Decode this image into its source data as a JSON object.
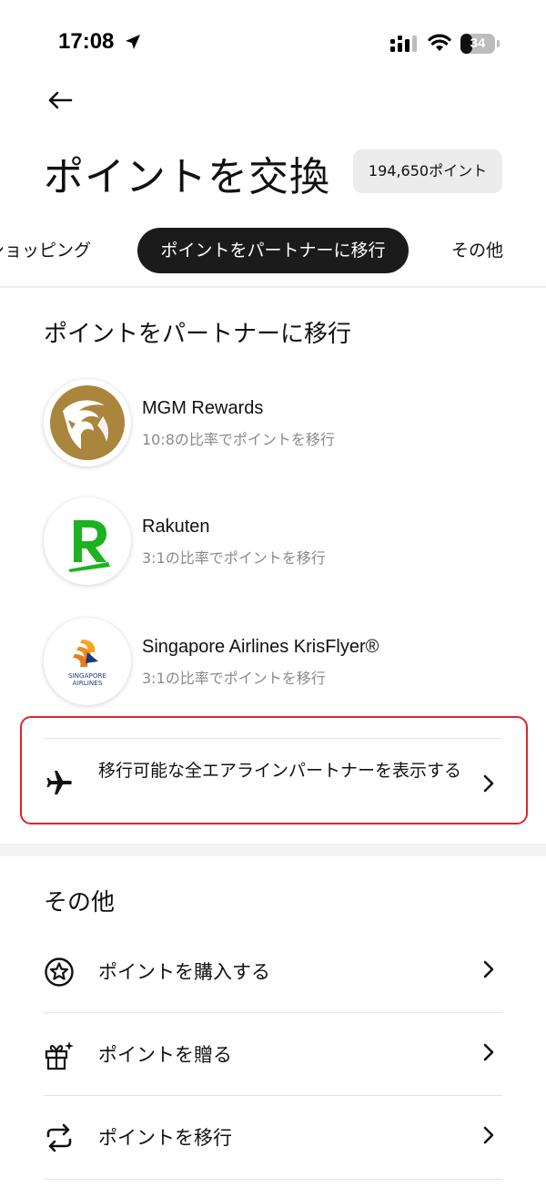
{
  "status_bar": {
    "time": "17:08",
    "battery_level": "34",
    "icons": [
      "location-arrow-icon",
      "signal-icon",
      "wifi-icon",
      "battery-icon"
    ]
  },
  "header": {
    "back_icon": "arrow-left-icon",
    "title": "ポイントを交換",
    "points_badge": "194,650ポイント"
  },
  "tabs": [
    {
      "label": "ショッピング",
      "active": false
    },
    {
      "label": "ポイントをパートナーに移行",
      "active": true
    },
    {
      "label": "その他",
      "active": false
    }
  ],
  "partners_section": {
    "title": "ポイントをパートナーに移行",
    "partners": [
      {
        "name": "MGM Rewards",
        "ratio": "10:8の比率でポイントを移行",
        "logo": "mgm-lion-logo",
        "color": "#A9853D"
      },
      {
        "name": "Rakuten",
        "ratio": "3:1の比率でポイントを移行",
        "logo": "rakuten-r-logo",
        "color": "#1DB21F"
      },
      {
        "name": "Singapore Airlines KrisFlyer®",
        "ratio": "3:1の比率でポイントを移行",
        "logo": "singapore-airlines-bird-logo",
        "logo_text_line1": "SINGAPORE",
        "logo_text_line2": "AIRLINES",
        "color": "#1D3B7B"
      }
    ],
    "view_all": {
      "label": "移行可能な全エアラインパートナーを表示する",
      "icon": "airplane-icon"
    }
  },
  "other_section": {
    "title": "その他",
    "items": [
      {
        "label": "ポイントを購入する",
        "icon": "star-circle-icon"
      },
      {
        "label": "ポイントを贈る",
        "icon": "gift-sparkle-icon"
      },
      {
        "label": "ポイントを移行",
        "icon": "transfer-arrows-icon"
      }
    ]
  },
  "colors": {
    "highlight": "#E0242B",
    "active_tab": "#1B1B1B",
    "badge_bg": "#ECECEC"
  }
}
